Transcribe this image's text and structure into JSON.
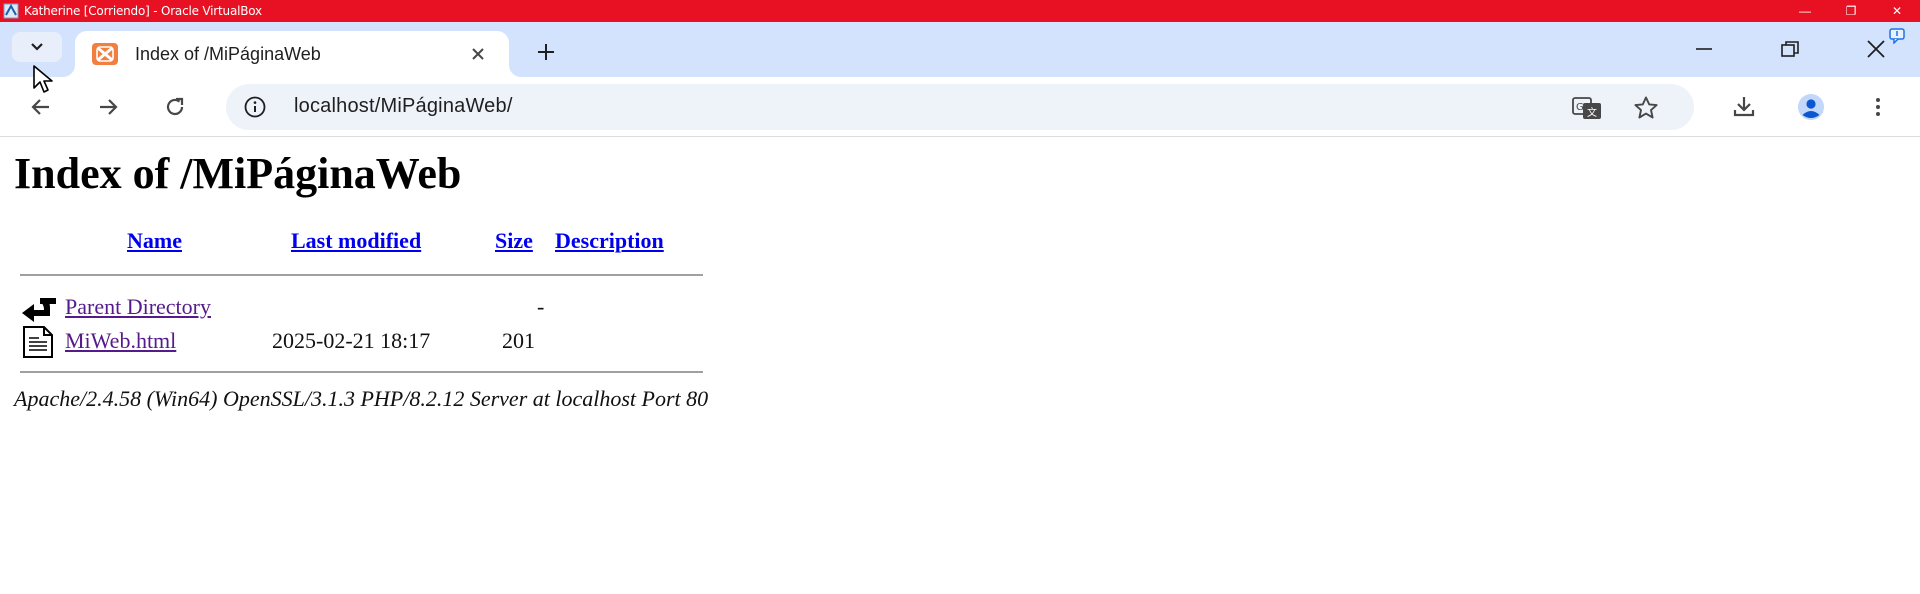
{
  "vbox": {
    "title": "Katherine [Corriendo] - Oracle VirtualBox",
    "minimize_glyph": "—",
    "restore_glyph": "❐",
    "close_glyph": "✕"
  },
  "browser": {
    "tab_title": "Index of /MiPáginaWeb",
    "url": "localhost/MiPáginaWeb/"
  },
  "page": {
    "heading": "Index of /MiPáginaWeb",
    "columns": {
      "name": "Name",
      "last_modified": "Last modified",
      "size": "Size",
      "description": "Description"
    },
    "rows": [
      {
        "name": "Parent Directory",
        "modified": "",
        "size": "-",
        "icon": "back-arrow-icon"
      },
      {
        "name": "MiWeb.html",
        "modified": "2025-02-21 18:17",
        "size": "201",
        "icon": "text-file-icon"
      }
    ],
    "address": "Apache/2.4.58 (Win64) OpenSSL/3.1.3 PHP/8.2.12 Server at localhost Port 80"
  },
  "colors": {
    "vbox_bar": "#e81123",
    "tabstrip": "#d3e3fd",
    "link": "#0000ee",
    "visited_link": "#551a8b"
  }
}
